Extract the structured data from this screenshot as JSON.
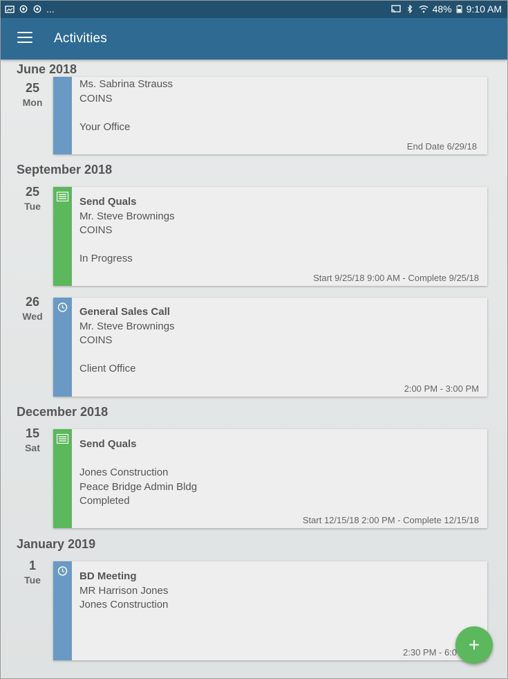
{
  "status_bar": {
    "battery": "48%",
    "time": "9:10 AM",
    "overflow_indicator": "...",
    "icons_left": [
      "screenshot-icon",
      "sync-icon",
      "sync-icon"
    ],
    "icons_right": [
      "cast-icon",
      "bluetooth-icon",
      "wifi-icon",
      "battery-icon"
    ]
  },
  "app_bar": {
    "title": "Activities",
    "menu_icon": "hamburger-menu-icon",
    "color": "#2e6a92"
  },
  "sections": [
    {
      "month": "June 2018",
      "activities": [
        {
          "day_number": "25",
          "day_name": "Mon",
          "strip_color": "blue",
          "icon": "",
          "lines": [
            "Ms. Sabrina Strauss",
            "COINS",
            "",
            "Your Office"
          ],
          "footer": "End Date 6/29/18"
        }
      ]
    },
    {
      "month": "September 2018",
      "activities": [
        {
          "day_number": "25",
          "day_name": "Tue",
          "strip_color": "green",
          "icon": "task-list-icon",
          "lines": [
            "Send Quals",
            "Mr. Steve Brownings",
            "COINS",
            "",
            "In Progress"
          ],
          "footer": "Start 9/25/18 9:00 AM - Complete 9/25/18"
        },
        {
          "day_number": "26",
          "day_name": "Wed",
          "strip_color": "blue",
          "icon": "clock-icon",
          "lines": [
            "General Sales Call",
            "Mr. Steve Brownings",
            "COINS",
            "",
            "Client Office"
          ],
          "footer": "2:00 PM - 3:00 PM"
        }
      ]
    },
    {
      "month": "December 2018",
      "activities": [
        {
          "day_number": "15",
          "day_name": "Sat",
          "strip_color": "green",
          "icon": "task-list-icon",
          "lines": [
            "Send Quals",
            "",
            "Jones Construction",
            "Peace Bridge Admin Bldg",
            "Completed"
          ],
          "footer": "Start 12/15/18 2:00 PM - Complete 12/15/18"
        }
      ]
    },
    {
      "month": "January 2019",
      "activities": [
        {
          "day_number": "1",
          "day_name": "Tue",
          "strip_color": "blue",
          "icon": "clock-icon",
          "lines": [
            "BD Meeting",
            "MR Harrison Jones",
            "Jones Construction"
          ],
          "footer": "2:30 PM - 6:0"
        }
      ]
    }
  ],
  "fab": {
    "label": "+",
    "icon": "add-icon",
    "color": "#5cb85c"
  },
  "colors": {
    "blue_strip": "#6a9ac4",
    "green_strip": "#5cb85c"
  }
}
